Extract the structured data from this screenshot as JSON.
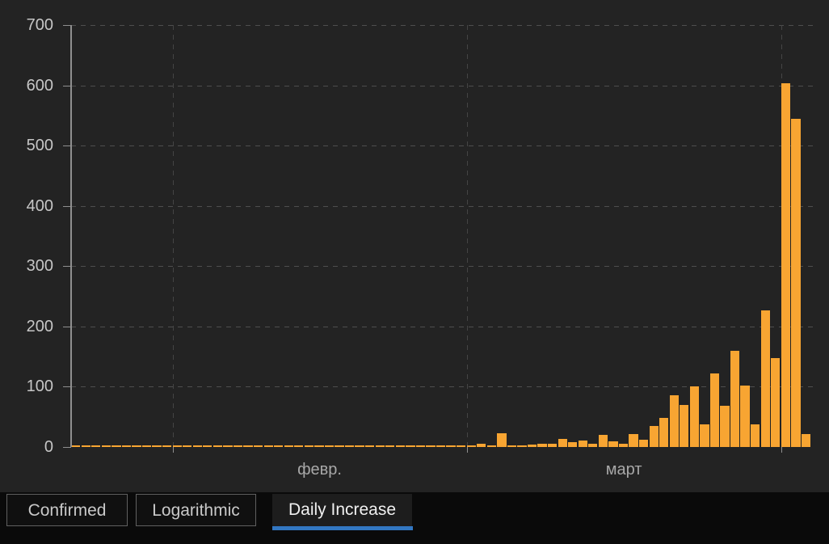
{
  "tabs": [
    {
      "label": "Confirmed",
      "active": false
    },
    {
      "label": "Logarithmic",
      "active": false
    },
    {
      "label": "Daily Increase",
      "active": true
    }
  ],
  "colors": {
    "background": "#232323",
    "footer_background": "#0a0a0a",
    "bar": "#f8a532",
    "grid_horizontal": "#4e4e4e",
    "grid_vertical": "#454545",
    "axis": "#8f8f8f",
    "tick_label": "#c6c6c6",
    "month_label": "#a8a8a8",
    "tab_border": "#606060",
    "tab_background": "#101010",
    "tab_active_background": "#1d1d1d",
    "tab_text": "#c9c9c9",
    "tab_active_text": "#f0f0f0",
    "active_tab_underline": "#3277c2"
  },
  "chart_data": {
    "type": "bar",
    "title": "",
    "xlabel": "",
    "ylabel": "",
    "ylim": [
      0,
      700
    ],
    "y_ticks": [
      0,
      100,
      200,
      300,
      400,
      500,
      600,
      700
    ],
    "grid": "dashed",
    "legend": "none",
    "bar_color": "#f8a532",
    "x_tick_labels": [
      "февр.",
      "март"
    ],
    "month_ticks": [
      {
        "index": 10,
        "label": "февр."
      },
      {
        "index": 39,
        "label": "март"
      },
      {
        "index": 70,
        "label": ""
      }
    ],
    "x": [
      "2020-01-22",
      "2020-01-23",
      "2020-01-24",
      "2020-01-25",
      "2020-01-26",
      "2020-01-27",
      "2020-01-28",
      "2020-01-29",
      "2020-01-30",
      "2020-01-31",
      "2020-02-01",
      "2020-02-02",
      "2020-02-03",
      "2020-02-04",
      "2020-02-05",
      "2020-02-06",
      "2020-02-07",
      "2020-02-08",
      "2020-02-09",
      "2020-02-10",
      "2020-02-11",
      "2020-02-12",
      "2020-02-13",
      "2020-02-14",
      "2020-02-15",
      "2020-02-16",
      "2020-02-17",
      "2020-02-18",
      "2020-02-19",
      "2020-02-20",
      "2020-02-21",
      "2020-02-22",
      "2020-02-23",
      "2020-02-24",
      "2020-02-25",
      "2020-02-26",
      "2020-02-27",
      "2020-02-28",
      "2020-02-29",
      "2020-03-01",
      "2020-03-02",
      "2020-03-03",
      "2020-03-04",
      "2020-03-05",
      "2020-03-06",
      "2020-03-07",
      "2020-03-08",
      "2020-03-09",
      "2020-03-10",
      "2020-03-11",
      "2020-03-12",
      "2020-03-13",
      "2020-03-14",
      "2020-03-15",
      "2020-03-16",
      "2020-03-17",
      "2020-03-18",
      "2020-03-19",
      "2020-03-20",
      "2020-03-21",
      "2020-03-22",
      "2020-03-23",
      "2020-03-24",
      "2020-03-25",
      "2020-03-26",
      "2020-03-27",
      "2020-03-28",
      "2020-03-29",
      "2020-03-30",
      "2020-03-31",
      "2020-04-01",
      "2020-04-02",
      "2020-04-03"
    ],
    "values": [
      1,
      1,
      1,
      1,
      1,
      1,
      1,
      1,
      1,
      1,
      1,
      1,
      1,
      1,
      1,
      1,
      1,
      1,
      1,
      1,
      1,
      1,
      1,
      1,
      1,
      1,
      1,
      1,
      1,
      1,
      1,
      1,
      1,
      1,
      1,
      1,
      1,
      1,
      1,
      2,
      5,
      1,
      23,
      3,
      1,
      4,
      6,
      6,
      14,
      8,
      11,
      6,
      20,
      9,
      5,
      22,
      12,
      35,
      48,
      86,
      70,
      100,
      37,
      122,
      69,
      160,
      102,
      37,
      227,
      148,
      604,
      545,
      22
    ]
  }
}
